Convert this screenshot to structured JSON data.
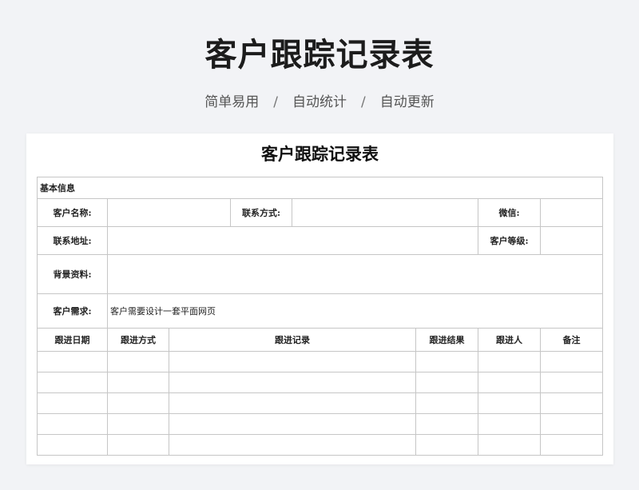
{
  "header": {
    "title": "客户跟踪记录表",
    "taglines": [
      "简单易用",
      "自动统计",
      "自动更新"
    ],
    "separator": "/"
  },
  "sheet": {
    "title": "客户跟踪记录表",
    "basic_section": "基本信息",
    "labels": {
      "name": "客户名称:",
      "contact": "联系方式:",
      "wechat": "微信:",
      "address": "联系地址:",
      "level": "客户等级:",
      "background": "背景资料:",
      "needs": "客户需求:"
    },
    "values": {
      "name": "",
      "contact": "",
      "wechat": "",
      "address": "",
      "level": "",
      "background": "",
      "needs": "客户需要设计一套平面网页"
    },
    "columns": [
      "跟进日期",
      "跟进方式",
      "跟进记录",
      "跟进结果",
      "跟进人",
      "备注"
    ]
  }
}
